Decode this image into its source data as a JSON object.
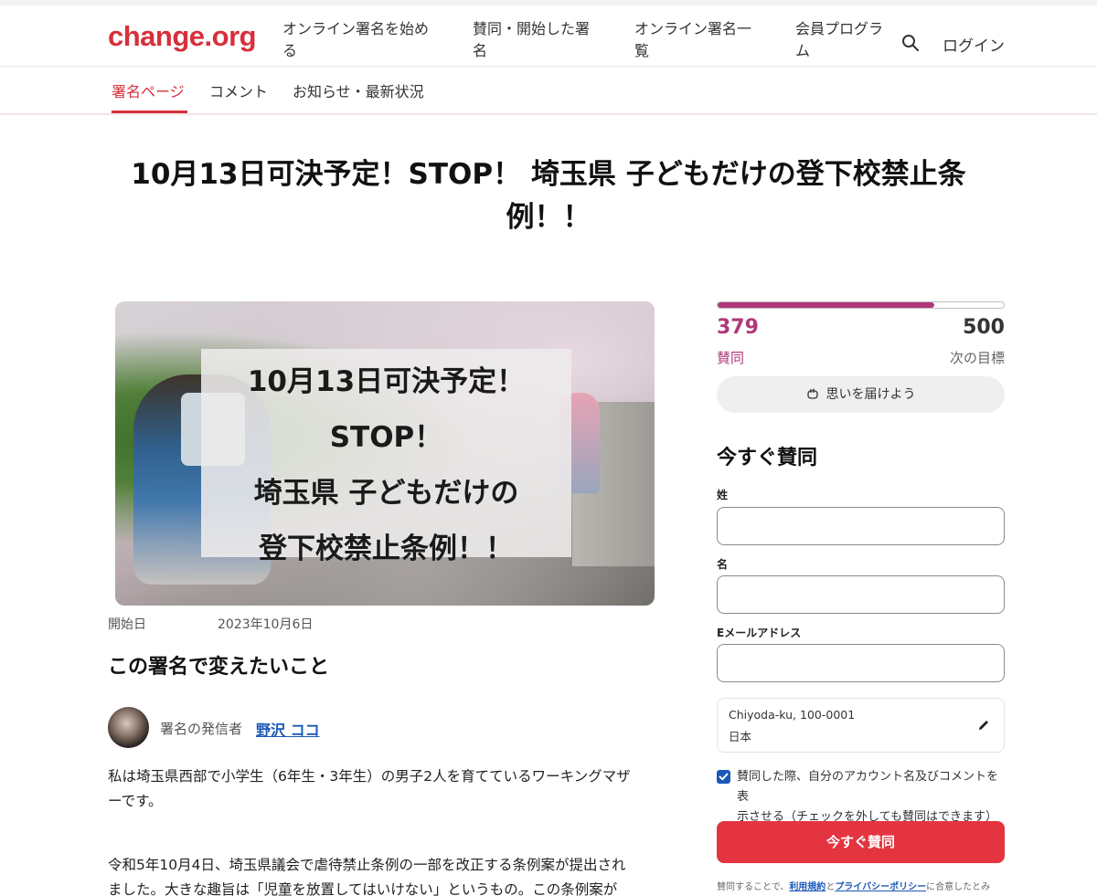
{
  "header": {
    "logo": "change.org",
    "nav": [
      {
        "line1": "オンライン署名を始め",
        "line2": "る"
      },
      {
        "line1": "賛同・開始した署",
        "line2": "名"
      },
      {
        "line1": "オンライン署名一",
        "line2": "覧"
      },
      {
        "line1": "会員プログラ",
        "line2": "ム"
      }
    ],
    "search_icon": "search-icon",
    "login": "ログイン"
  },
  "tabs": [
    {
      "label": "署名ページ",
      "active": true
    },
    {
      "label": "コメント",
      "active": false
    },
    {
      "label": "お知らせ・最新状況",
      "active": false
    }
  ],
  "petition": {
    "title_line1": "10月13日可決予定！STOP！ 埼玉県 子どもだけの登下校禁止条",
    "title_line2": "例！！",
    "image_text": [
      "10月13日可決予定！",
      "STOP！",
      "埼玉県 子どもだけの",
      "登下校禁止条例！！"
    ],
    "start_label": "開始日",
    "start_date": "2023年10月6日",
    "section_heading": "この署名で変えたいこと",
    "starter_label": "署名の発信者",
    "starter_name": "野沢 ココ",
    "body": [
      {
        "line1": "私は埼玉県西部で小学生（6年生・3年生）の男子2人を育てているワーキングマザ",
        "line2": "ーです。"
      },
      {
        "line1": "令和5年10月4日、埼玉県議会で虐待禁止条例の一部を改正する条例案が提出され",
        "line2": "ました。大きな趣旨は「児童を放置してはいけない」というもの。この条例案が"
      }
    ]
  },
  "sidebar": {
    "signatures": "379",
    "signatures_label": "賛同",
    "goal": "500",
    "goal_label": "次の目標",
    "progress_fraction": 0.758,
    "share_button": "思いを届けよう",
    "sign_heading": "今すぐ賛同",
    "fields": {
      "last_name_label": "姓",
      "first_name_label": "名",
      "email_label": "Eメールアドレス"
    },
    "location_line1": "Chiyoda-ku, 100-0001",
    "location_line2": "日本",
    "consent_checked": true,
    "consent_line1": "賛同した際、自分のアカウント名及びコメントを表",
    "consent_line2": "示させる（チェックを外しても賛同はできます）",
    "sign_button": "今すぐ賛同",
    "terms_prefix": "賛同することで、",
    "terms_link": "利用規約",
    "terms_and": "と",
    "privacy_link": "プライバシーポリシー",
    "terms_suffix": "に合意したとみ"
  },
  "colors": {
    "brand": "#d6303c",
    "progress": "#b0377a",
    "button": "#e3343f",
    "link": "#1a58b8"
  }
}
